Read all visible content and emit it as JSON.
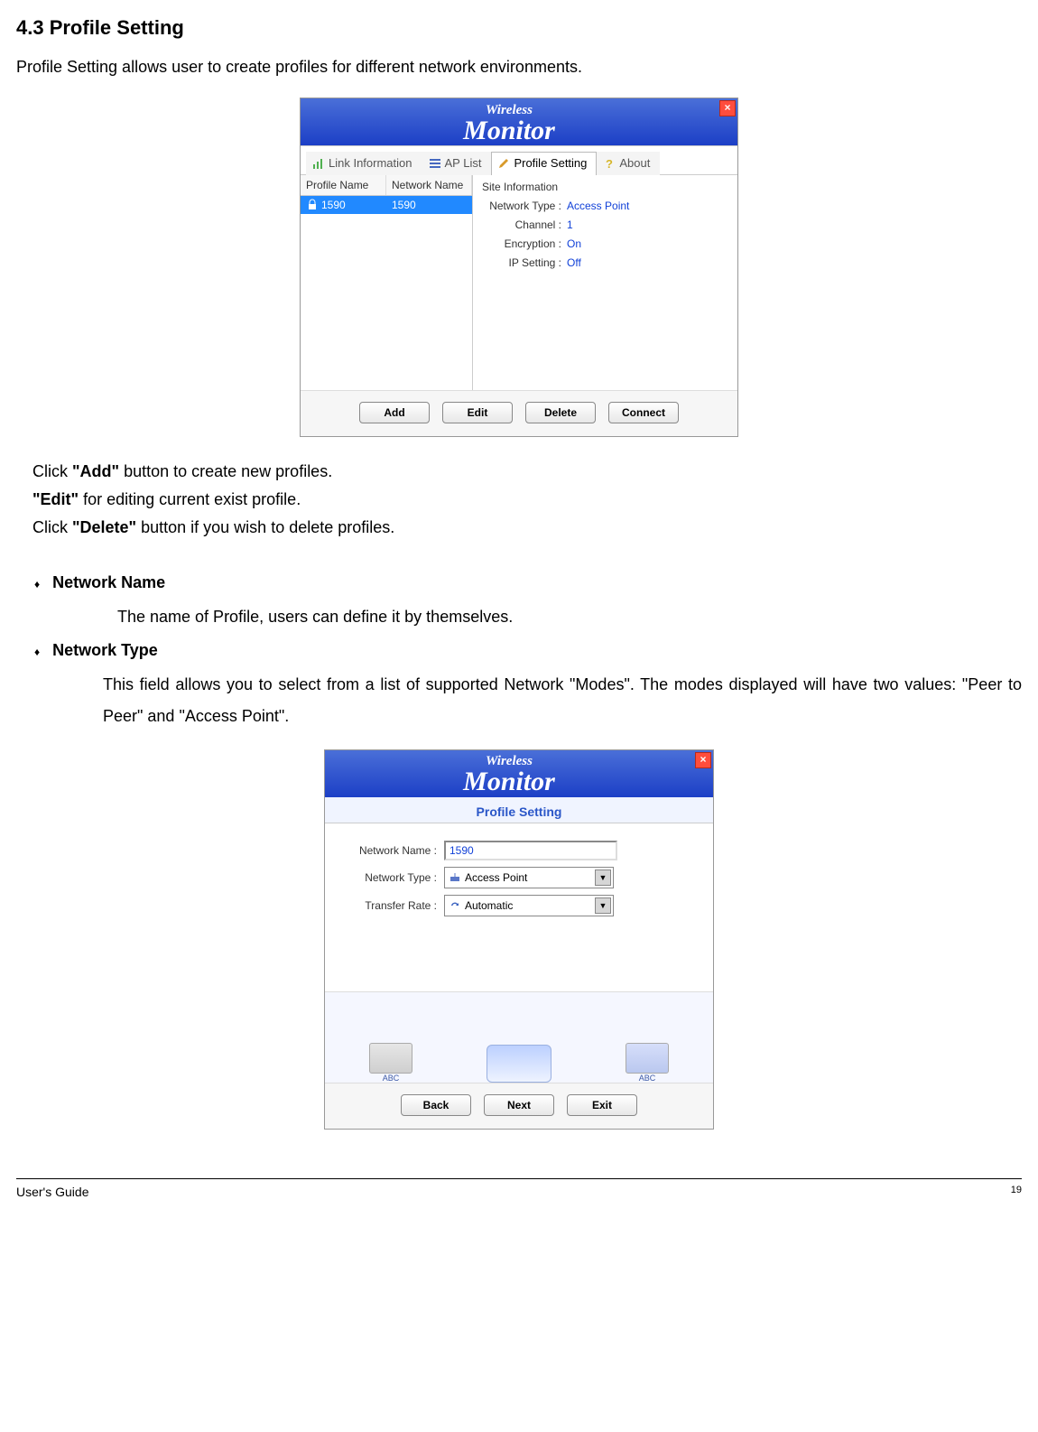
{
  "heading": "4.3 Profile Setting",
  "intro": "Profile Setting allows user to create profiles for different network environments.",
  "win1": {
    "title_top": "Wireless",
    "title_bottom": "Monitor",
    "tabs": {
      "link_info": "Link Information",
      "ap_list": "AP List",
      "profile_setting": "Profile Setting",
      "about": "About"
    },
    "cols": {
      "profile_name": "Profile Name",
      "network_name": "Network Name"
    },
    "row": {
      "profile_name": "1590",
      "network_name": "1590"
    },
    "site_title": "Site Information",
    "kv": {
      "network_type_k": "Network Type :",
      "network_type_v": "Access Point",
      "channel_k": "Channel :",
      "channel_v": "1",
      "encryption_k": "Encryption :",
      "encryption_v": "On",
      "ip_k": "IP Setting :",
      "ip_v": "Off"
    },
    "buttons": {
      "add": "Add",
      "edit": "Edit",
      "delete": "Delete",
      "connect": "Connect"
    }
  },
  "body_text": {
    "l1a": "Click ",
    "l1b": "\"Add\"",
    "l1c": " button to create new profiles.",
    "l2a": "\"Edit\"",
    "l2b": " for editing current exist profile.",
    "l3a": "Click ",
    "l3b": "\"Delete\"",
    "l3c": " button if you wish to delete profiles."
  },
  "bullets": {
    "b1_title": "Network Name",
    "b1_body": "The name of Profile, users can define it by themselves.",
    "b2_title": "Network Type",
    "b2_body": "This field allows you to select from a list of supported Network \"Modes\".   The modes displayed will have two values:  \"Peer to Peer\" and \"Access Point\"."
  },
  "win2": {
    "title_top": "Wireless",
    "title_bottom": "Monitor",
    "section_title": "Profile Setting",
    "rows": {
      "netname_l": "Network Name :",
      "netname_v": "1590",
      "nettype_l": "Network Type :",
      "nettype_v": "Access Point",
      "rate_l": "Transfer Rate :",
      "rate_v": "Automatic"
    },
    "dev": {
      "a": "ABC",
      "b": "ABC"
    },
    "buttons": {
      "back": "Back",
      "next": "Next",
      "exit": "Exit"
    }
  },
  "footer": {
    "left": "User's Guide",
    "right": "19"
  }
}
